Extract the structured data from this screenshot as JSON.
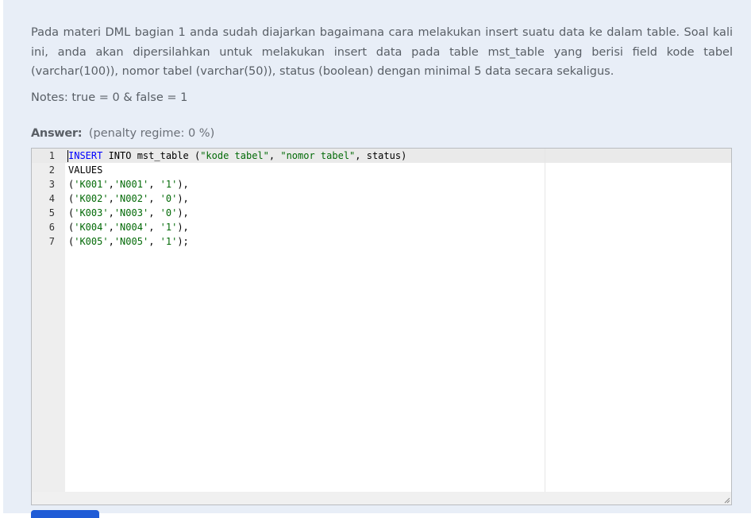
{
  "question": {
    "text": "Pada materi DML bagian 1 anda sudah diajarkan bagaimana cara melakukan insert suatu data ke dalam table. Soal kali ini, anda akan dipersilahkan untuk melakukan insert data pada table mst_table yang berisi field kode tabel (varchar(100)), nomor tabel (varchar(50)), status (boolean) dengan minimal 5 data secara sekaligus.",
    "notes": "Notes: true = 0 & false = 1"
  },
  "answer": {
    "label": "Answer:",
    "penalty": "(penalty regime: 0 %)"
  },
  "editor": {
    "lines": [
      {
        "num": "1",
        "parts": [
          {
            "t": "INSERT",
            "c": "kw"
          },
          {
            "t": " INTO mst_table (",
            "c": ""
          },
          {
            "t": "\"kode tabel\"",
            "c": "str"
          },
          {
            "t": ", ",
            "c": ""
          },
          {
            "t": "\"nomor tabel\"",
            "c": "str"
          },
          {
            "t": ", status)",
            "c": ""
          }
        ]
      },
      {
        "num": "2",
        "parts": [
          {
            "t": "VALUES",
            "c": ""
          }
        ]
      },
      {
        "num": "3",
        "parts": [
          {
            "t": "(",
            "c": ""
          },
          {
            "t": "'K001'",
            "c": "str"
          },
          {
            "t": ",",
            "c": ""
          },
          {
            "t": "'N001'",
            "c": "str"
          },
          {
            "t": ", ",
            "c": ""
          },
          {
            "t": "'1'",
            "c": "str"
          },
          {
            "t": "),",
            "c": ""
          }
        ]
      },
      {
        "num": "4",
        "parts": [
          {
            "t": "(",
            "c": ""
          },
          {
            "t": "'K002'",
            "c": "str"
          },
          {
            "t": ",",
            "c": ""
          },
          {
            "t": "'N002'",
            "c": "str"
          },
          {
            "t": ", ",
            "c": ""
          },
          {
            "t": "'0'",
            "c": "str"
          },
          {
            "t": "),",
            "c": ""
          }
        ]
      },
      {
        "num": "5",
        "parts": [
          {
            "t": "(",
            "c": ""
          },
          {
            "t": "'K003'",
            "c": "str"
          },
          {
            "t": ",",
            "c": ""
          },
          {
            "t": "'N003'",
            "c": "str"
          },
          {
            "t": ", ",
            "c": ""
          },
          {
            "t": "'0'",
            "c": "str"
          },
          {
            "t": "),",
            "c": ""
          }
        ]
      },
      {
        "num": "6",
        "parts": [
          {
            "t": "(",
            "c": ""
          },
          {
            "t": "'K004'",
            "c": "str"
          },
          {
            "t": ",",
            "c": ""
          },
          {
            "t": "'N004'",
            "c": "str"
          },
          {
            "t": ", ",
            "c": ""
          },
          {
            "t": "'1'",
            "c": "str"
          },
          {
            "t": "),",
            "c": ""
          }
        ]
      },
      {
        "num": "7",
        "parts": [
          {
            "t": "(",
            "c": ""
          },
          {
            "t": "'K005'",
            "c": "str"
          },
          {
            "t": ",",
            "c": ""
          },
          {
            "t": "'N005'",
            "c": "str"
          },
          {
            "t": ", ",
            "c": ""
          },
          {
            "t": "'1'",
            "c": "str"
          },
          {
            "t": ");",
            "c": ""
          }
        ]
      }
    ]
  },
  "colors": {
    "keyword": "#0000ff",
    "string": "#036a07",
    "button": "#1f5bd6"
  },
  "icons": {
    "resize": "resize-grip-icon"
  }
}
